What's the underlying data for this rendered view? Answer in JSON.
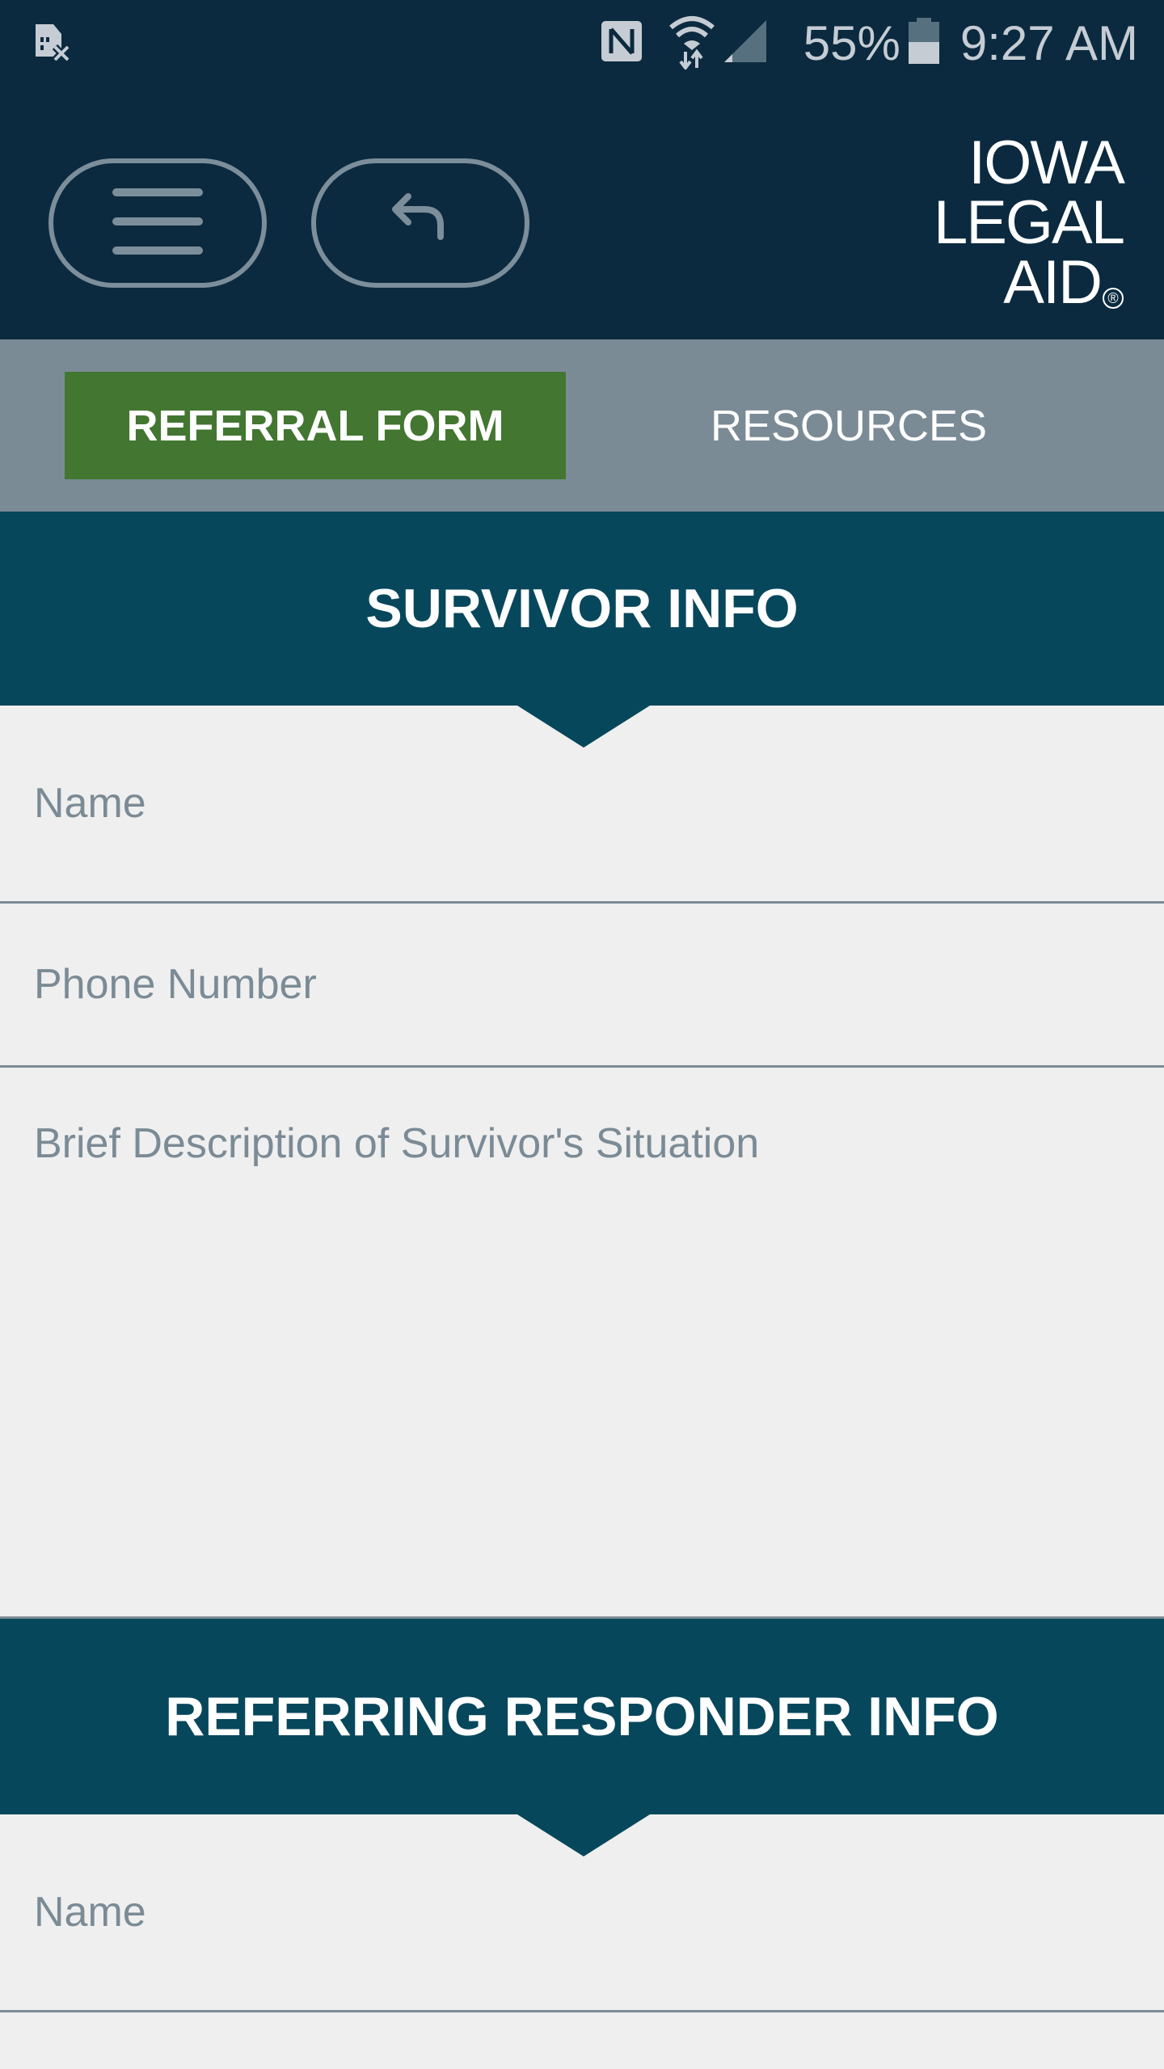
{
  "status_bar": {
    "left_icons": [
      "no-sim-icon"
    ],
    "right_icons": [
      "nfc-icon",
      "wifi-data-icon",
      "signal-icon",
      "battery-icon"
    ],
    "battery_percent": "55%",
    "battery_level": 0.55,
    "time": "9:27 AM"
  },
  "header": {
    "menu_button": "menu",
    "back_button": "back",
    "logo_lines": [
      "IOWA",
      "LEGAL",
      "AID"
    ],
    "logo_mark": "®"
  },
  "tabs": [
    {
      "label": "REFERRAL FORM",
      "active": true
    },
    {
      "label": "RESOURCES",
      "active": false
    }
  ],
  "sections": [
    {
      "title": "SURVIVOR INFO",
      "fields": [
        {
          "placeholder": "Name",
          "value": ""
        },
        {
          "placeholder": "Phone Number",
          "value": ""
        },
        {
          "placeholder": "Brief Description of Survivor's Situation",
          "value": ""
        }
      ]
    },
    {
      "title": "REFERRING RESPONDER INFO",
      "fields": [
        {
          "placeholder": "Name",
          "value": ""
        }
      ]
    }
  ],
  "colors": {
    "header_bg": "#0b2a3f",
    "tab_bar_bg": "#7b8b96",
    "active_tab": "#437631",
    "section_bg": "#07475c",
    "page_bg": "#efefef",
    "placeholder": "#7b8b96"
  }
}
